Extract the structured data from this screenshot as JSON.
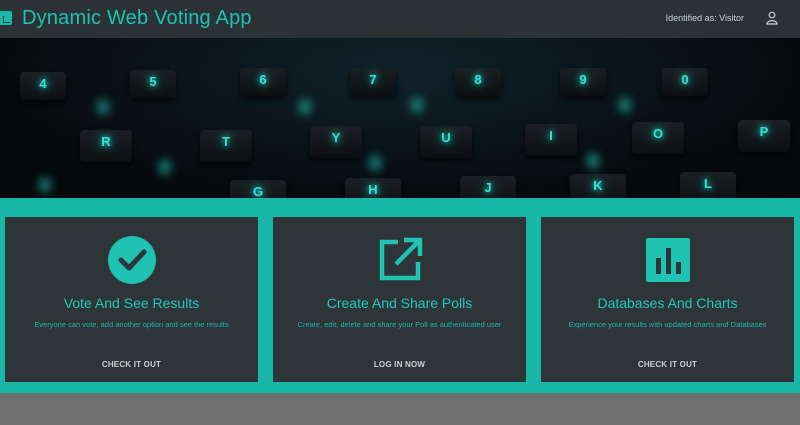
{
  "app": {
    "title": "Dynamic Web Voting App",
    "identity_text": "Identified as: Visitor"
  },
  "hero": {
    "keys": [
      {
        "label": "4"
      },
      {
        "label": "5"
      },
      {
        "label": "6"
      },
      {
        "label": "7"
      },
      {
        "label": "8"
      },
      {
        "label": "9"
      },
      {
        "label": "0"
      },
      {
        "label": "R"
      },
      {
        "label": "T"
      },
      {
        "label": "Y"
      },
      {
        "label": "U"
      },
      {
        "label": "I"
      },
      {
        "label": "O"
      },
      {
        "label": "P"
      },
      {
        "label": "G"
      },
      {
        "label": "H"
      },
      {
        "label": "J"
      },
      {
        "label": "K"
      },
      {
        "label": "L"
      }
    ]
  },
  "cards": [
    {
      "icon": "check-circle-icon",
      "title": "Vote And See Results",
      "description": "Everyone can vote, add another option and see the results",
      "cta": "CHECK IT OUT"
    },
    {
      "icon": "external-link-icon",
      "title": "Create And Share Polls",
      "description": "Create, edit, delete and share your Poll as authenticated user",
      "cta": "LOG IN NOW"
    },
    {
      "icon": "bar-chart-icon",
      "title": "Databases And Charts",
      "description": "Experience your results with updated charts and Databases",
      "cta": "CHECK IT OUT"
    }
  ],
  "colors": {
    "accent": "#1ec3b4",
    "navbar": "#2a3236",
    "card": "#2e3539"
  }
}
